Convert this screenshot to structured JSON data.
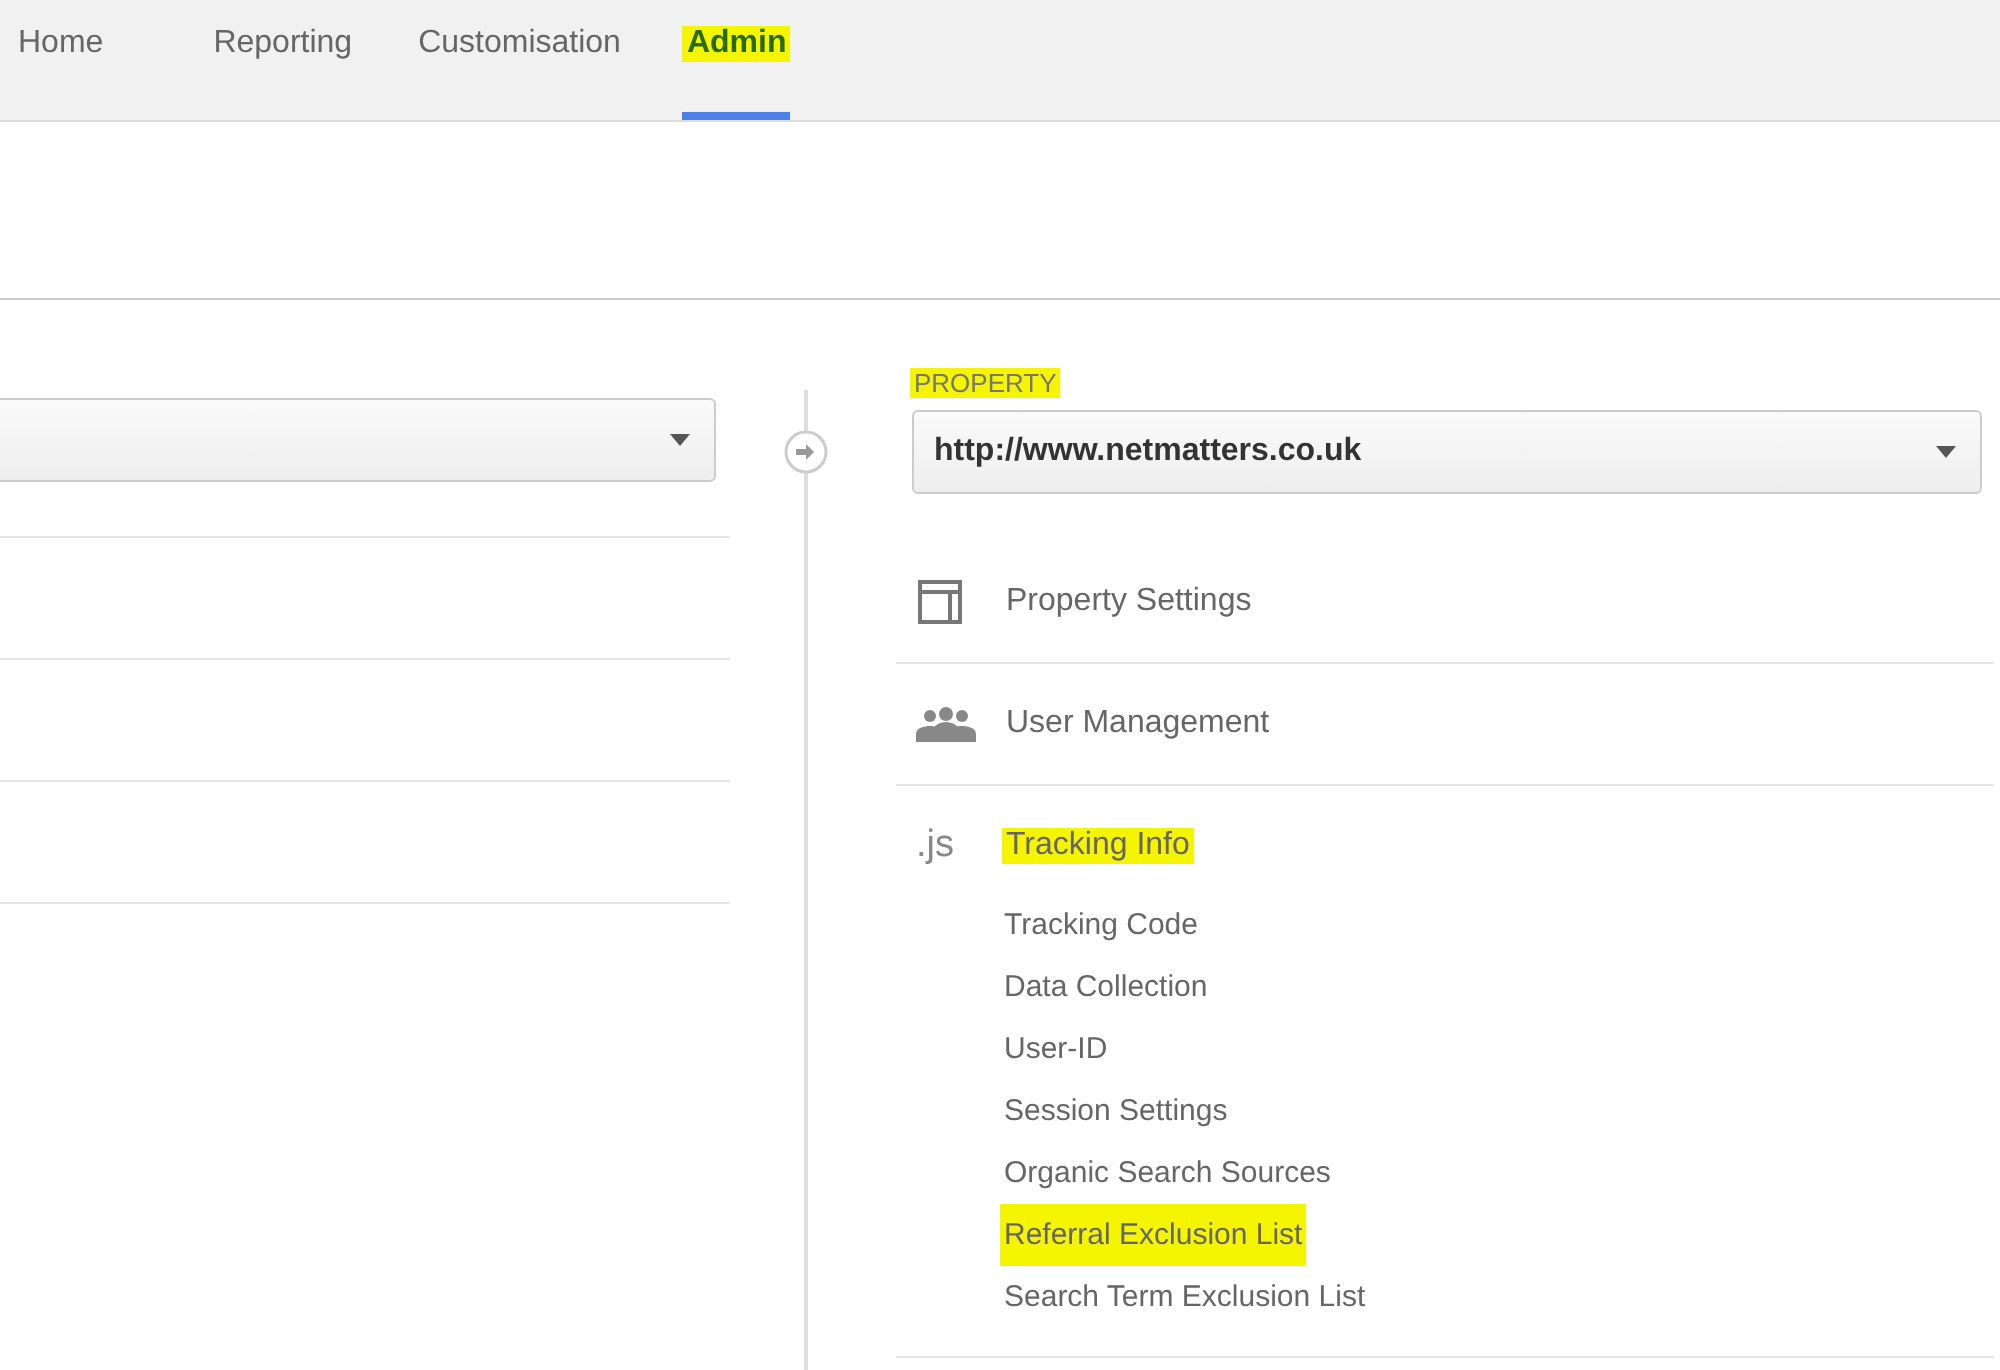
{
  "tabs": [
    {
      "label": "Home",
      "selected": false,
      "highlighted": false
    },
    {
      "label": "Reporting",
      "selected": false,
      "highlighted": false
    },
    {
      "label": "Customisation",
      "selected": false,
      "highlighted": false
    },
    {
      "label": "Admin",
      "selected": true,
      "highlighted": true
    }
  ],
  "property": {
    "label": "PROPERTY",
    "highlighted": true,
    "value": "http://www.netmatters.co.uk"
  },
  "menu": [
    {
      "kind": "settings",
      "label": "Property Settings",
      "highlighted": false
    },
    {
      "kind": "users",
      "label": "User Management",
      "highlighted": false
    },
    {
      "kind": "js",
      "icon_text": ".js",
      "label": "Tracking Info",
      "highlighted": true,
      "children": [
        {
          "label": "Tracking Code",
          "highlighted": false
        },
        {
          "label": "Data Collection",
          "highlighted": false
        },
        {
          "label": "User-ID",
          "highlighted": false
        },
        {
          "label": "Session Settings",
          "highlighted": false
        },
        {
          "label": "Organic Search Sources",
          "highlighted": false
        },
        {
          "label": "Referral Exclusion List",
          "highlighted": true
        },
        {
          "label": "Search Term Exclusion List",
          "highlighted": false
        }
      ]
    }
  ]
}
